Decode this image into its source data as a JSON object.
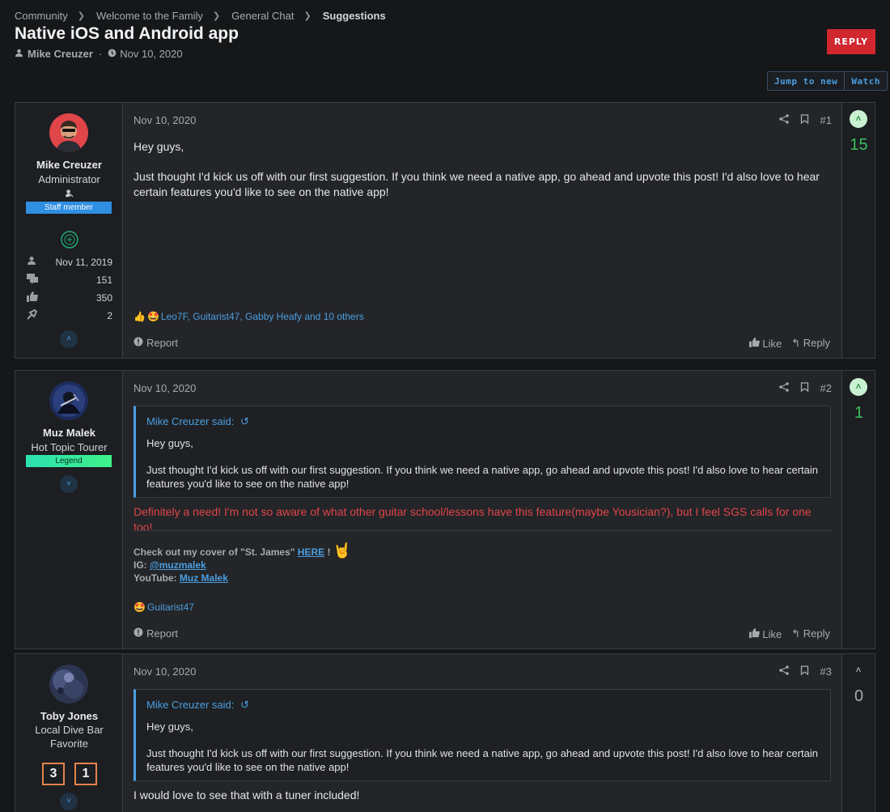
{
  "breadcrumb": [
    "Community",
    "Welcome to the Family",
    "General Chat",
    "Suggestions"
  ],
  "thread": {
    "title": "Native iOS and Android app",
    "author": "Mike Creuzer",
    "date": "Nov 10, 2020",
    "reply_label": "REPLY",
    "jump_label": "Jump to new",
    "watch_label": "Watch"
  },
  "posts": [
    {
      "author": "Mike Creuzer",
      "title": "Administrator",
      "badge": "Staff member",
      "joined": "Nov 11, 2019",
      "messages": "151",
      "reactions": "350",
      "points": "2",
      "date": "Nov 10, 2020",
      "num": "#1",
      "text1": "Hey guys,",
      "text2": "Just thought I'd kick us off with our first suggestion. If you think we need a native app, go ahead and upvote this post! I'd also love to hear certain features you'd like to see on the native app!",
      "reacted_by": "Leo7F, Guitarist47, Gabby Heafy and 10 others",
      "report": "Report",
      "like": "Like",
      "reply": "Reply",
      "votes": "15"
    },
    {
      "author": "Muz Malek",
      "title": "Hot Topic Tourer",
      "badge": "Legend",
      "date": "Nov 10, 2020",
      "num": "#2",
      "quote_head": "Mike Creuzer said:",
      "quote1": "Hey guys,",
      "quote2": "Just thought I'd kick us off with our first suggestion. If you think we need a native app, go ahead and upvote this post! I'd also love to hear certain features you'd like to see on the native app!",
      "text": "Definitely a need! I'm not so aware of what other guitar school/lessons have this feature(maybe Yousician?), but I feel SGS calls for one too!",
      "sig_line1_prefix": "Check out my cover of \"St. James\"",
      "sig_line1_link": "HERE",
      "sig_line1_suffix": "!",
      "sig_ig_label": "IG:",
      "sig_ig_link": "@muzmalek",
      "sig_yt_label": "YouTube:",
      "sig_yt_link": "Muz Malek",
      "reacted_by": "Guitarist47",
      "report": "Report",
      "like": "Like",
      "reply": "Reply",
      "votes": "1"
    },
    {
      "author": "Toby Jones",
      "title": "Local Dive Bar Favorite",
      "trophy1": "3",
      "trophy2": "1",
      "date": "Nov 10, 2020",
      "num": "#3",
      "quote_head": "Mike Creuzer said:",
      "quote1": "Hey guys,",
      "quote2": "Just thought I'd kick us off with our first suggestion. If you think we need a native app, go ahead and upvote this post! I'd also love to hear certain features you'd like to see on the native app!",
      "text": "I would love to see that with a tuner included!",
      "votes": "0"
    }
  ],
  "colors": {
    "background": "#151719",
    "accent": "#4b9ee0",
    "reply_button": "#d1272f",
    "vote_positive": "#3bbf5d",
    "post2_text": "#e0454a"
  }
}
